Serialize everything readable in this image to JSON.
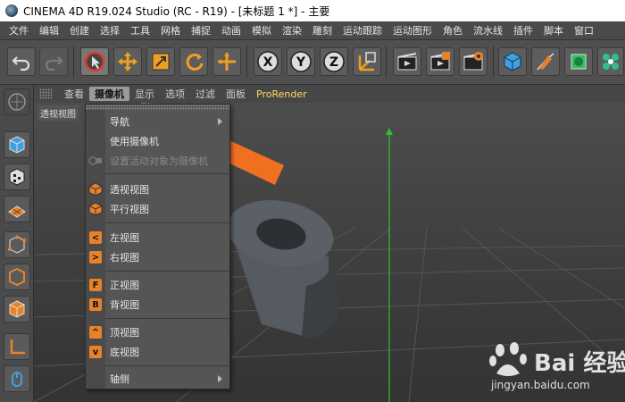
{
  "window": {
    "title": "CINEMA 4D R19.024 Studio (RC - R19) - [未标题 1 *] - 主要"
  },
  "menubar": {
    "items": [
      "文件",
      "编辑",
      "创建",
      "选择",
      "工具",
      "网格",
      "捕捉",
      "动画",
      "模拟",
      "渲染",
      "雕刻",
      "运动跟踪",
      "运动图形",
      "角色",
      "流水线",
      "插件",
      "脚本",
      "窗口"
    ]
  },
  "toolbar": {
    "icons": [
      "undo-icon",
      "redo-icon",
      "select-icon",
      "move-icon",
      "scale-icon",
      "rotate-icon",
      "live-select-icon",
      "x-axis-icon",
      "y-axis-icon",
      "z-axis-icon",
      "coordinate-icon",
      "render-view-icon",
      "render-picture-icon",
      "render-settings-icon",
      "cube-icon",
      "pen-icon",
      "subdivision-icon",
      "cloner-icon"
    ],
    "axis_labels": {
      "x": "X",
      "y": "Y",
      "z": "Z"
    }
  },
  "viewport_menu": {
    "items": [
      "查看",
      "摄像机",
      "显示",
      "选项",
      "过滤",
      "面板",
      "ProRender"
    ],
    "active": "摄像机"
  },
  "viewport": {
    "label": "透视视图"
  },
  "camera_menu": {
    "items": [
      {
        "label": "导航",
        "has_submenu": true
      },
      {
        "label": "使用摄像机"
      },
      {
        "label": "设置活动对象为摄像机",
        "disabled": true
      },
      {
        "label": "透视视图"
      },
      {
        "label": "平行视图"
      },
      {
        "label": "左视图",
        "icon_letter": "<"
      },
      {
        "label": "右视图",
        "icon_letter": ">"
      },
      {
        "label": "正视图",
        "icon_letter": "F"
      },
      {
        "label": "背视图",
        "icon_letter": "B"
      },
      {
        "label": "顶视图",
        "icon_letter": "^"
      },
      {
        "label": "底视图",
        "icon_letter": "v"
      },
      {
        "label": "轴侧",
        "has_submenu": true
      }
    ]
  },
  "watermark": {
    "brand": "Bai 经验",
    "url": "jingyan.baidu.com"
  },
  "colors": {
    "accent_orange": "#e8822a",
    "arrow_orange": "#f07020",
    "axis_green": "#2fbf2f"
  }
}
